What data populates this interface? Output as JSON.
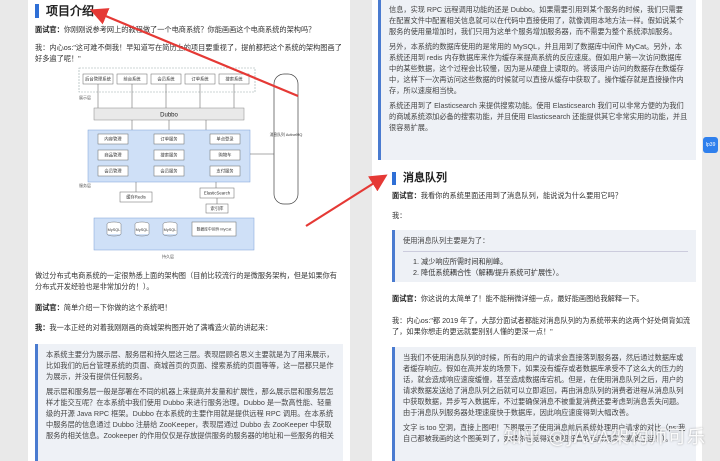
{
  "left": {
    "title": "项目介绍",
    "p1_a": "面试官：",
    "p1_b": "你刚刚说参考网上的教程做了一个电商系统？你能画画这个电商系统的架构吗？",
    "p2": "我：内心os:\"这可难不倒我！早知道写在简历上的项目要重视了，提前都把这个系统的架构图画了好多遍了呢！\"",
    "diagram": {
      "top_row": [
        "后台管理系统",
        "前台系统",
        "会员系统",
        "订单系统",
        "搜索系统"
      ],
      "display_label": "展示层",
      "center": "Dubbo",
      "services_row1": [
        "内容管理",
        "订单服务",
        "单点登录"
      ],
      "services_row2": [
        "商品管理",
        "搜索服务",
        "购物车"
      ],
      "services_row3": [
        "会员管理",
        "会员服务",
        "支付服务"
      ],
      "service_label": "服务层",
      "mq_label": "消息队列 ActiveMQ",
      "cache": "缓存Redis",
      "es": "ElasticSearch",
      "index": "索引库",
      "dbs": [
        "MySQL",
        "MySQL",
        "MySQL"
      ],
      "mycat": "数据库中间件 MyCat",
      "data_label": "持久层"
    },
    "p3": "做过分布式电商系统的一定很熟悉上面的架构图（目前比较流行的是微服务架构，但是如果你有分布式开发经验也是非常加分的！）。",
    "p4_a": "面试官：",
    "p4_b": "简单介绍一下你做的这个系统吧！",
    "p5_a": "我：",
    "p5_b": "我一本正经的对着我刚刚画的商城架构图开始了满嘴造火箭的讲起来：",
    "quote1": "本系统主要分为展示层、服务层和持久层这三层。表现层顾名思义主要就是为了用来展示，比如我们的后台管理系统的页面、商城首页的页面、搜索系统的页面等等，这一层都只是作为展示，并没有提供任何服务。",
    "quote2": "展示层和服务层一般是部署在不同的机器上来提高并发量和扩展性，那么展示层和服务层怎样才能交互呢？在本系统中我们使用 Dubbo 来进行服务治理。Dubbo 是一款高性能、轻量级的开源 Java RPC 框架。Dubbo 在本系统的主要作用就是提供远程 RPC 调用。在本系统中服务层的信息通过 Dubbo 注册给 ZooKeeper，表现层通过 Dubbo 去 ZooKeeper 中获取服务的相关信息。Zookeeper 的作用仅仅是存放提供服务的服务器的地址和一些服务的相关"
  },
  "right": {
    "q_top_1": "信息，实现 RPC 远程调用功能的还是 Dubbo。如果需要引用到某个服务的时候，我们只需要在配置文件中配置相关信息就可以在代码中直接使用了，就像调用本地方法一样。假如说某个服务的使用量增加时，我们只用为这单个服务增加服务器，而不需要为整个系统添加服务。",
    "q_top_2": "另外，本系统的数据库使用的是常用的 MySQL，并且用到了数据库中间件 MyCat。另外，本系统还用到 redis 内存数据库来作为缓存来提高系统的反应速度。假如用户第一次访问数据库中的某些数据，这个过程会比较慢，因为是从硬盘上读取的。将该用户访问的数据存在数缓存中，这样下一次再访问这些数据的时候就可以直接从缓存中获取了。操作缓存就是直接操作内存，所以速度相当快。",
    "q_top_3": "系统还用到了 Elasticsearch 来提供搜索功能。使用 Elasticsearch 我们可以非常方便的为我们的商城系统添加必备的搜索功能，并且使用 Elasticsearch 还能提供其它非常实用的功能，并且很容易扩展。",
    "title": "消息队列",
    "p1_a": "面试官：",
    "p1_b": "我看你的系统里面还用到了消息队列，能说说为什么要用它吗？",
    "p2": "我：",
    "quote_intro": "使用消息队列主要是为了：",
    "quote_items": [
      "减少响应所需时间和削峰。",
      "降低系统耦合性（解耦/提升系统可扩展性）。"
    ],
    "p3_a": "面试官：",
    "p3_b": "你这说的太简单了！能不能稍微详细一点，最好能画图给我解释一下。",
    "p4": "我：内心os:\"都 2019 年了，大部分面试者都能对消息队列的为系统带来的这两个好处倒背如流了，如果你想走的更远就要别别人懂的更深一点！\"",
    "quote2_1": "当我们不使用消息队列的时候，所有的用户的请求会直接落到服务器，然后通过数据库或者缓存响应。假如在高并发的场景下，如果没有缓存或者数据库承受不了这么大的压力的话，就会造成响应速度缓慢，甚至造成数据库宕机。但是，在使用消息队列之后，用户的请求数据发送给了消息队列之后就可以立即返回，再由消息队列的消费者进程从消息队列中获取数据，异步写入数据库，不过要确保消息不被重复消费还要考虑到消息丢失问题。由于消息队列服务器处理速度快于数据库，因此响应速度得到大幅改善。",
    "quote2_2": "文字 is too 空洞，直接上图吧！下图展示了使用消息前后系统处理用户请求的对比（ps:我自己都被我画的这个图美到了，如果你也觉得这张图好看的话麻烦来个素质三连！）。"
  },
  "side_badge": "Ip39",
  "watermark": "知乎 @JAVA架构师可乐",
  "colors": {
    "accent": "#2f6fd6",
    "arrow": "#e53935",
    "quote_bg": "#eef1f6"
  }
}
